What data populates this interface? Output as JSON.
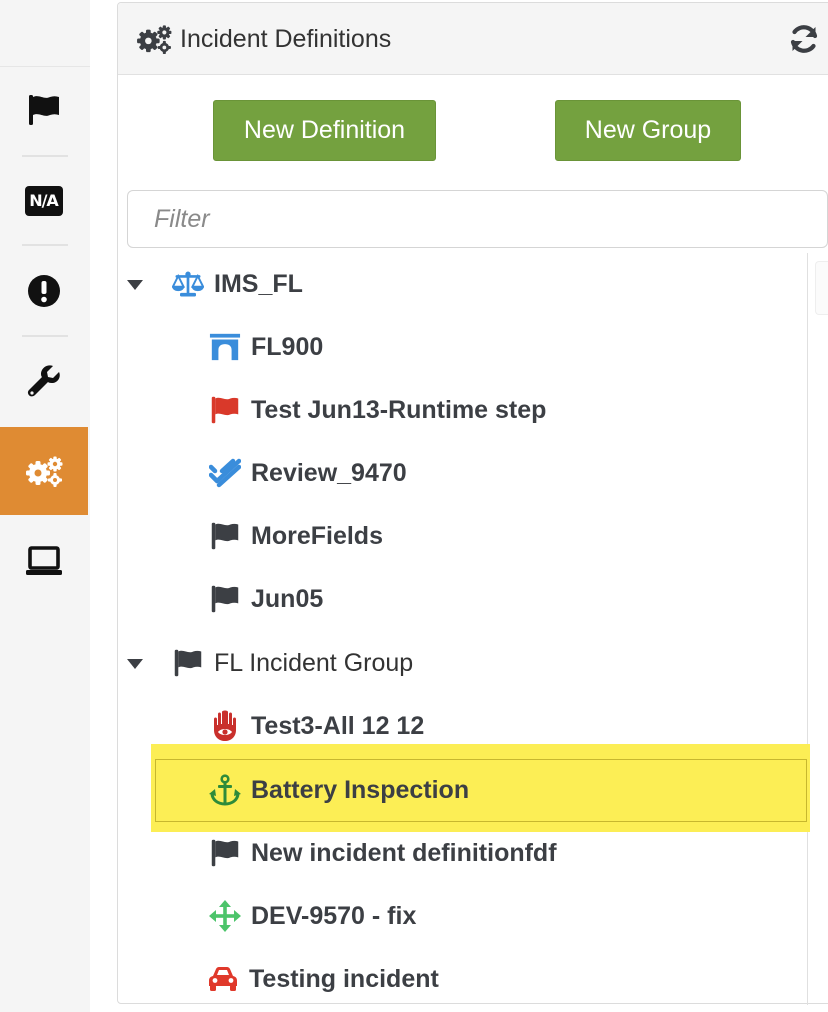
{
  "rail": {
    "items": [
      {
        "icon": "flag-icon",
        "active": false
      },
      {
        "icon": "na-icon",
        "label": "N/A",
        "active": false
      },
      {
        "icon": "exclamation-circle-icon",
        "active": false
      },
      {
        "icon": "wrench-icon",
        "active": false
      },
      {
        "icon": "cogs-icon",
        "active": true
      },
      {
        "icon": "laptop-icon",
        "active": false
      }
    ],
    "active_color": "#df8b33"
  },
  "panel": {
    "title": "Incident Definitions",
    "refresh_icon": "refresh-icon",
    "buttons": {
      "new_definition": "New Definition",
      "new_group": "New Group",
      "color": "#74a13f"
    },
    "filter": {
      "placeholder": "Filter",
      "value": ""
    }
  },
  "tree": {
    "groups": [
      {
        "name": "IMS_FL",
        "icon": "balance-scale-icon",
        "expanded": true,
        "items": [
          {
            "label": "FL900",
            "icon": "archway-icon"
          },
          {
            "label": "Test Jun13-Runtime step",
            "icon": "red-flag-icon"
          },
          {
            "label": "Review_9470",
            "icon": "check-double-icon"
          },
          {
            "label": "MoreFields",
            "icon": "flag-icon"
          },
          {
            "label": "Jun05",
            "icon": "flag-icon"
          }
        ]
      },
      {
        "name": "FL Incident Group",
        "icon": "flag-icon",
        "expanded": true,
        "items": [
          {
            "label": "Test3-All 12 12",
            "icon": "hamsa-icon"
          },
          {
            "label": "Battery Inspection",
            "icon": "anchor-icon",
            "selected": true
          },
          {
            "label": "New incident definitionfdf",
            "icon": "flag-icon"
          },
          {
            "label": "DEV-9570 - fix",
            "icon": "arrows-icon"
          },
          {
            "label": "Testing incident",
            "icon": "car-icon"
          }
        ]
      }
    ],
    "highlight_color": "#fcee55"
  }
}
